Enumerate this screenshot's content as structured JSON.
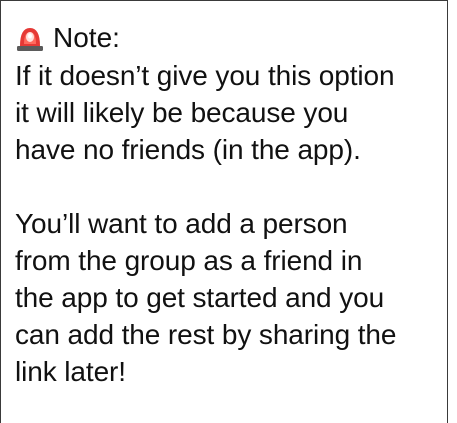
{
  "note": {
    "icon": "siren-icon",
    "title": "Note:",
    "paragraph_1_lines": [
      "If it doesn’t give you this option",
      "it will likely be because you",
      "have no friends (in the app)."
    ],
    "paragraph_2_lines": [
      "You’ll want to add a person",
      "from the group as a friend in",
      "the app to get started and you",
      "can add the rest by sharing the",
      "link later!"
    ]
  },
  "colors": {
    "border": "#3a3a3a",
    "siren_red": "#e53935",
    "text": "#111111"
  }
}
